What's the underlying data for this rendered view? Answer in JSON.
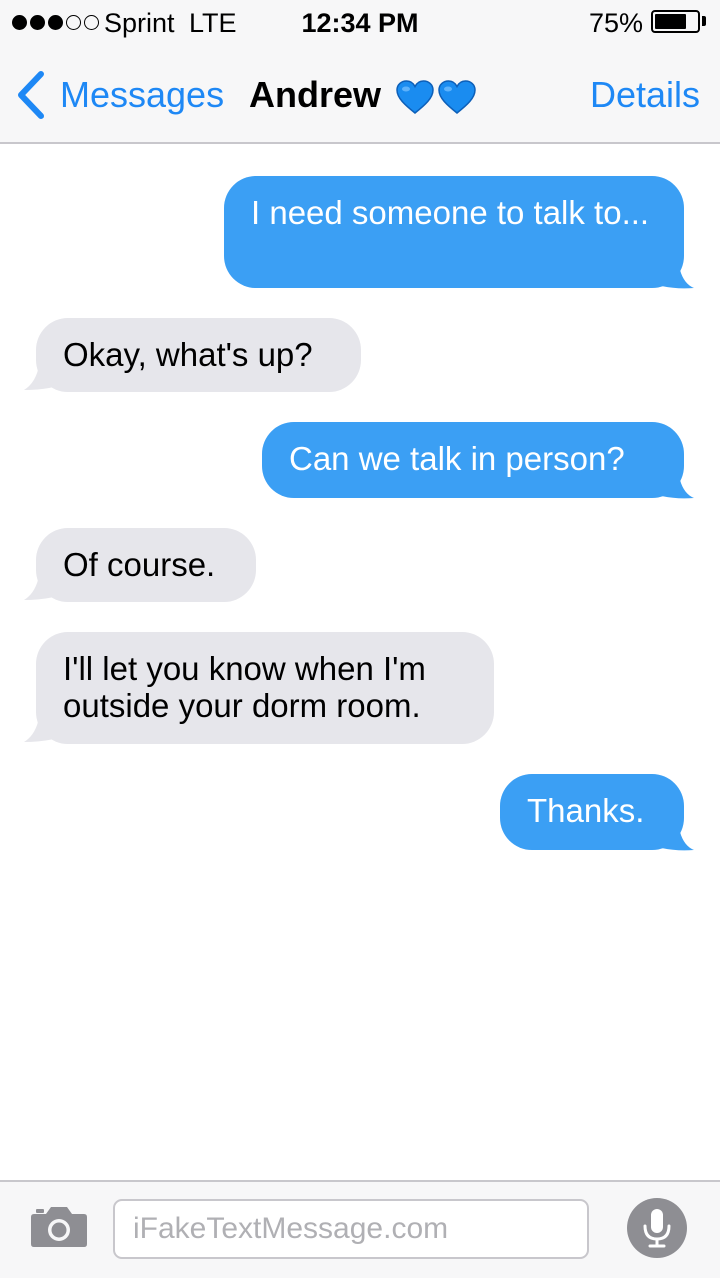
{
  "status_bar": {
    "signal_bars": 3,
    "signal_total": 5,
    "carrier": "Sprint",
    "network": "LTE",
    "time": "12:34 PM",
    "battery_percent": "75%",
    "battery_level": 0.75
  },
  "nav": {
    "back_label": "Messages",
    "contact_name": "Andrew",
    "contact_emoji": "blue-heart-icon x2",
    "details_label": "Details"
  },
  "messages": [
    {
      "direction": "sent",
      "text": "I need someone to talk to..."
    },
    {
      "direction": "received",
      "text": "Okay, what's up?"
    },
    {
      "direction": "sent",
      "text": "Can we talk in person?"
    },
    {
      "direction": "received",
      "text": "Of course."
    },
    {
      "direction": "received",
      "text": "I'll let you know when I'm outside your dorm room."
    },
    {
      "direction": "sent",
      "text": "Thanks."
    }
  ],
  "composer": {
    "placeholder": "iFakeTextMessage.com",
    "camera_icon": "camera-icon",
    "mic_icon": "microphone-icon"
  },
  "colors": {
    "accent": "#1e88f5",
    "sent_bubble": "#3b9ff4",
    "received_bubble": "#e6e6eb",
    "heart": "#1a8cf0"
  }
}
